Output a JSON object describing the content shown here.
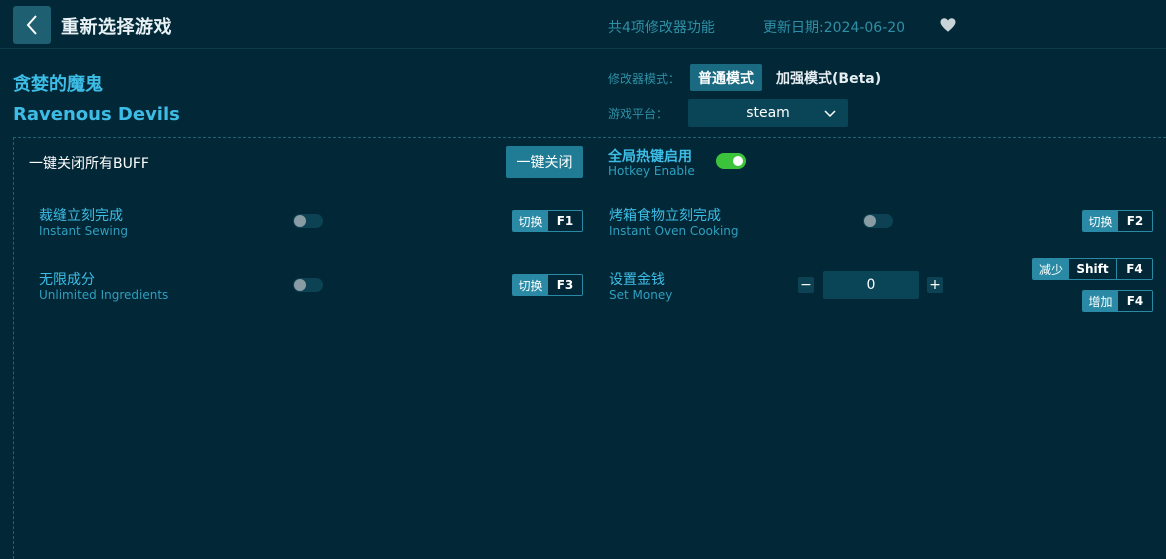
{
  "header": {
    "back_icon": "chevron-left-icon",
    "title": "重新选择游戏",
    "feature_count": "共4项修改器功能",
    "update_date": "更新日期:2024-06-20",
    "favorite_icon": "heart-icon"
  },
  "game": {
    "name_cn": "贪婪的魔鬼",
    "name_en": "Ravenous Devils"
  },
  "mode": {
    "label": "修改器模式：",
    "normal": "普通模式",
    "beta": "加强模式(Beta)",
    "selected": "普通模式"
  },
  "platform": {
    "label": "游戏平台：",
    "value": "steam"
  },
  "panel": {
    "buff_label": "一键关闭所有BUFF",
    "close_all": "一键关闭",
    "hotkey_cn": "全局热键启用",
    "hotkey_en": "Hotkey Enable",
    "hotkey_enabled": true
  },
  "options": [
    {
      "cn": "裁缝立刻完成",
      "en": "Instant Sewing",
      "enabled": false,
      "action": "切换",
      "key": "F1"
    },
    {
      "cn": "烤箱食物立刻完成",
      "en": "Instant Oven Cooking",
      "enabled": false,
      "action": "切换",
      "key": "F2"
    },
    {
      "cn": "无限成分",
      "en": "Unlimited Ingredients",
      "enabled": false,
      "action": "切换",
      "key": "F3"
    }
  ],
  "money": {
    "cn": "设置金钱",
    "en": "Set Money",
    "value": "0",
    "minus": "−",
    "plus": "+",
    "decrease": {
      "action": "减少",
      "mod": "Shift",
      "key": "F4"
    },
    "increase": {
      "action": "增加",
      "key": "F4"
    }
  },
  "colors": {
    "background": "#022837",
    "accent": "#3dbde6",
    "button": "#1f7c94",
    "toggle_on": "#3cc33c"
  }
}
